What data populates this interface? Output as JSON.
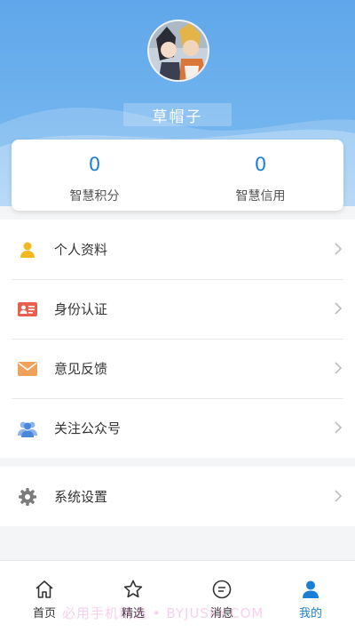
{
  "profile": {
    "username": "草帽子"
  },
  "stats": [
    {
      "value": "0",
      "label": "智慧积分"
    },
    {
      "value": "0",
      "label": "智慧信用"
    }
  ],
  "menu": {
    "items": [
      {
        "label": "个人资料",
        "icon": "person-icon",
        "color": "#f2b820"
      },
      {
        "label": "身份认证",
        "icon": "id-card-icon",
        "color": "#e8604d"
      },
      {
        "label": "意见反馈",
        "icon": "envelope-icon",
        "color": "#f0a15c"
      },
      {
        "label": "关注公众号",
        "icon": "group-icon",
        "color": "#5b93e0"
      }
    ],
    "settings": {
      "label": "系统设置",
      "icon": "gear-icon",
      "color": "#7b7b7b"
    }
  },
  "tabbar": {
    "tabs": [
      {
        "label": "首页",
        "icon": "home-icon"
      },
      {
        "label": "精选",
        "icon": "star-icon"
      },
      {
        "label": "消息",
        "icon": "message-icon"
      },
      {
        "label": "我的",
        "icon": "user-icon",
        "active": true
      }
    ]
  },
  "watermark": "必用手机精选 • BYJUSKY.COM",
  "colors": {
    "accent": "#1a7fd4",
    "header": "#5fa7ea"
  }
}
